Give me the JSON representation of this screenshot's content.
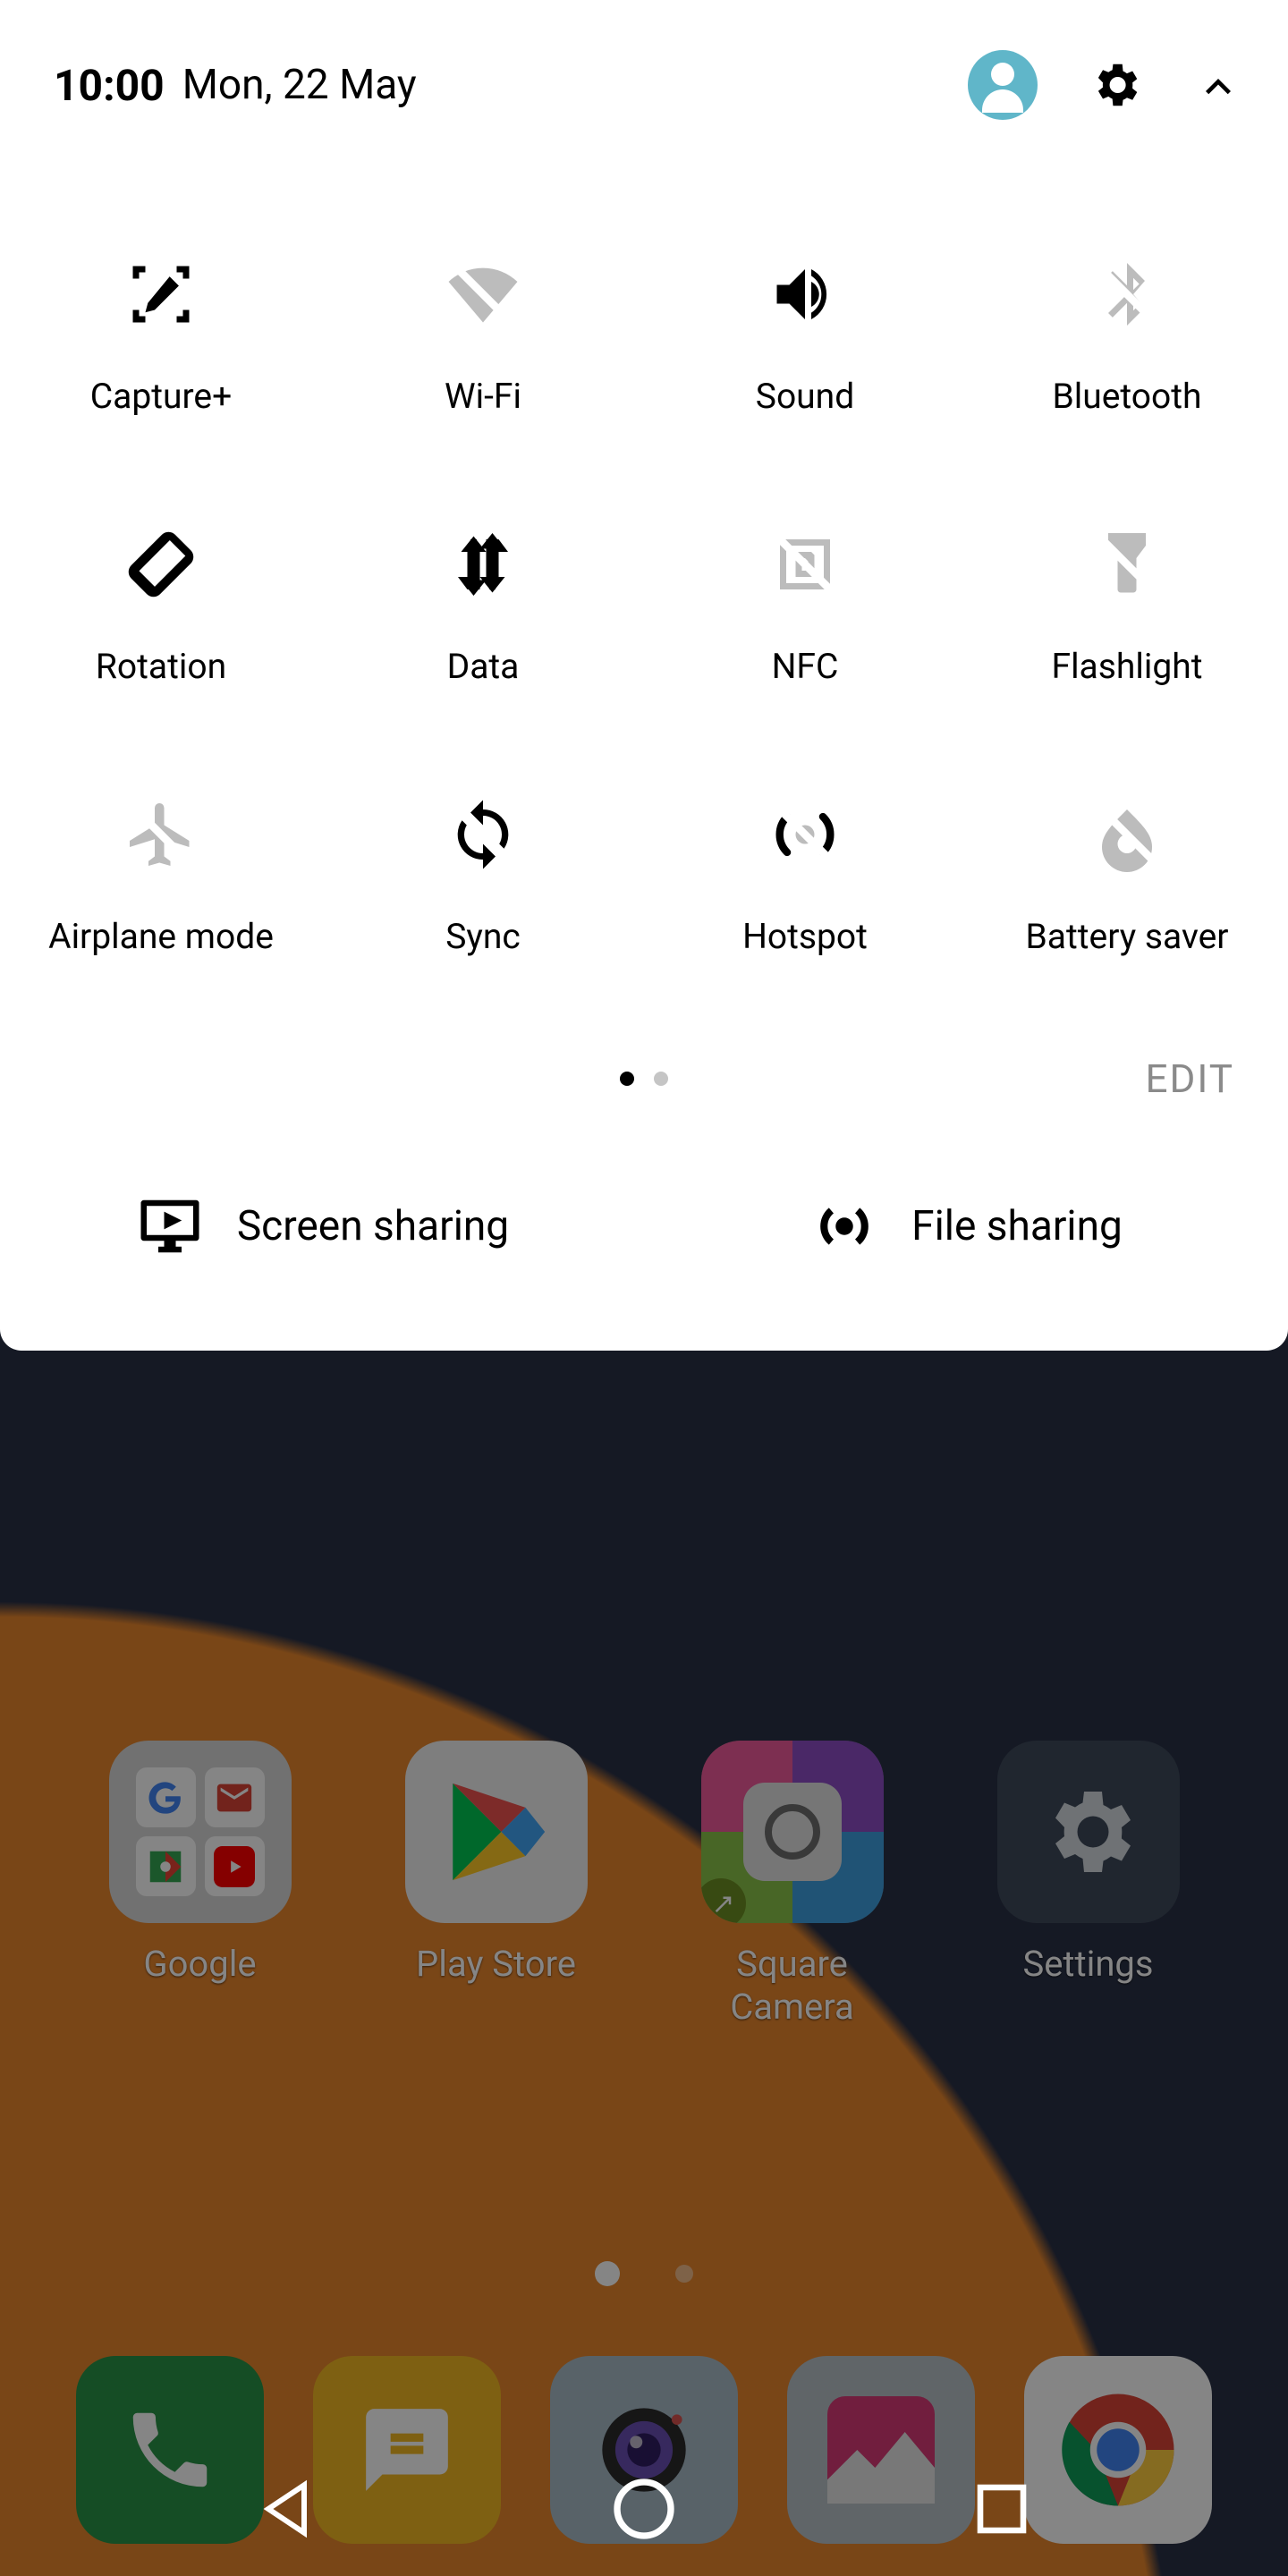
{
  "status": {
    "time": "10:00",
    "date": "Mon, 22 May"
  },
  "quick_settings": {
    "items": [
      {
        "label": "Capture+",
        "icon": "capture-plus-icon",
        "active": true
      },
      {
        "label": "Wi-Fi",
        "icon": "wifi-off-icon",
        "active": false
      },
      {
        "label": "Sound",
        "icon": "sound-icon",
        "active": true
      },
      {
        "label": "Bluetooth",
        "icon": "bluetooth-off-icon",
        "active": false
      },
      {
        "label": "Rotation",
        "icon": "rotation-icon",
        "active": true
      },
      {
        "label": "Data",
        "icon": "data-icon",
        "active": true
      },
      {
        "label": "NFC",
        "icon": "nfc-off-icon",
        "active": false
      },
      {
        "label": "Flashlight",
        "icon": "flashlight-off-icon",
        "active": false
      },
      {
        "label": "Airplane mode",
        "icon": "airplane-off-icon",
        "active": false
      },
      {
        "label": "Sync",
        "icon": "sync-icon",
        "active": true
      },
      {
        "label": "Hotspot",
        "icon": "hotspot-off-icon",
        "active": false
      },
      {
        "label": "Battery saver",
        "icon": "battery-saver-off-icon",
        "active": false
      }
    ],
    "page_count": 2,
    "current_page": 0,
    "edit_label": "EDIT"
  },
  "share_row": {
    "screen_sharing": "Screen sharing",
    "file_sharing": "File sharing"
  },
  "home_apps": [
    {
      "label": "Google",
      "icon": "google-folder-icon"
    },
    {
      "label": "Play Store",
      "icon": "play-store-icon"
    },
    {
      "label": "Square\nCamera",
      "icon": "square-camera-icon"
    },
    {
      "label": "Settings",
      "icon": "settings-icon"
    }
  ],
  "home_page_count": 2,
  "home_current_page": 0,
  "dock": [
    {
      "name": "phone",
      "color": "#2a9447"
    },
    {
      "name": "messages",
      "color": "#f2b823"
    },
    {
      "name": "camera",
      "color": "#a9bdc8"
    },
    {
      "name": "gallery",
      "color": "#b9c2c8"
    },
    {
      "name": "chrome",
      "color": "#e9e9e9"
    }
  ],
  "colors": {
    "avatar": "#60b6c9",
    "icon_off": "#bcbcbc",
    "icon_on": "#000000",
    "edit": "#8a8a8a"
  }
}
